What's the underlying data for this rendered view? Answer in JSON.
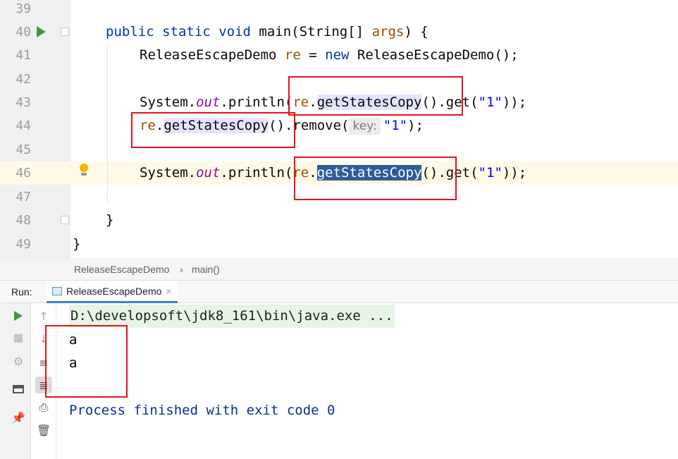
{
  "editor": {
    "line_numbers": [
      "39",
      "40",
      "41",
      "42",
      "43",
      "44",
      "45",
      "46",
      "47",
      "48",
      "49"
    ],
    "line40": {
      "kw1": "public",
      "kw2": "static",
      "kw3": "void",
      "name": "main(String[] ",
      "param": "args",
      "rest": ") {"
    },
    "line41": {
      "type": "ReleaseEscapeDemo ",
      "var": "re",
      "eq": " = ",
      "kw": "new",
      "rest": " ReleaseEscapeDemo();"
    },
    "line43": {
      "sys": "System.",
      "out": "out",
      "println": ".println(",
      "re": "re",
      "dot": ".",
      "method": "getStatesCopy",
      "call": "()",
      "get": ".get(",
      "str": "\"1\"",
      "close": "));"
    },
    "line44": {
      "re": "re",
      "dot": ".",
      "method": "getStatesCopy",
      "call": "()",
      "remove": ".remove(",
      "hint": "key:",
      "str": "\"1\"",
      "close": ");"
    },
    "line46": {
      "sys": "System.",
      "out": "out",
      "println": ".println(",
      "re": "re",
      "dot": ".",
      "method": "getStatesCopy",
      "call": "()",
      "get": ".get(",
      "str": "\"1\"",
      "close": "));"
    },
    "line48": "}",
    "line49": "}"
  },
  "breadcrumb": {
    "class_name": "ReleaseEscapeDemo",
    "separator": "›",
    "method": "main()"
  },
  "run_panel": {
    "label": "Run:",
    "tab_title": "ReleaseEscapeDemo",
    "tab_close": "×"
  },
  "console": {
    "command": "D:\\developsoft\\jdk8_161\\bin\\java.exe ...",
    "outputs": [
      "a",
      "a"
    ],
    "finish": "Process finished with exit code 0"
  },
  "colors": {
    "highlight_box": "#e0131f",
    "selection": "#2e5c9a",
    "keyword": "#0033b3"
  },
  "icons": [
    "run-gutter-icon",
    "fold-icon",
    "bulb-icon",
    "rerun-icon",
    "stop-icon",
    "rebuild-icon",
    "layout-icon",
    "pin-icon",
    "scroll-up-icon",
    "scroll-down-icon",
    "soft-wrap-icon",
    "scroll-end-icon",
    "print-icon",
    "trash-icon"
  ]
}
